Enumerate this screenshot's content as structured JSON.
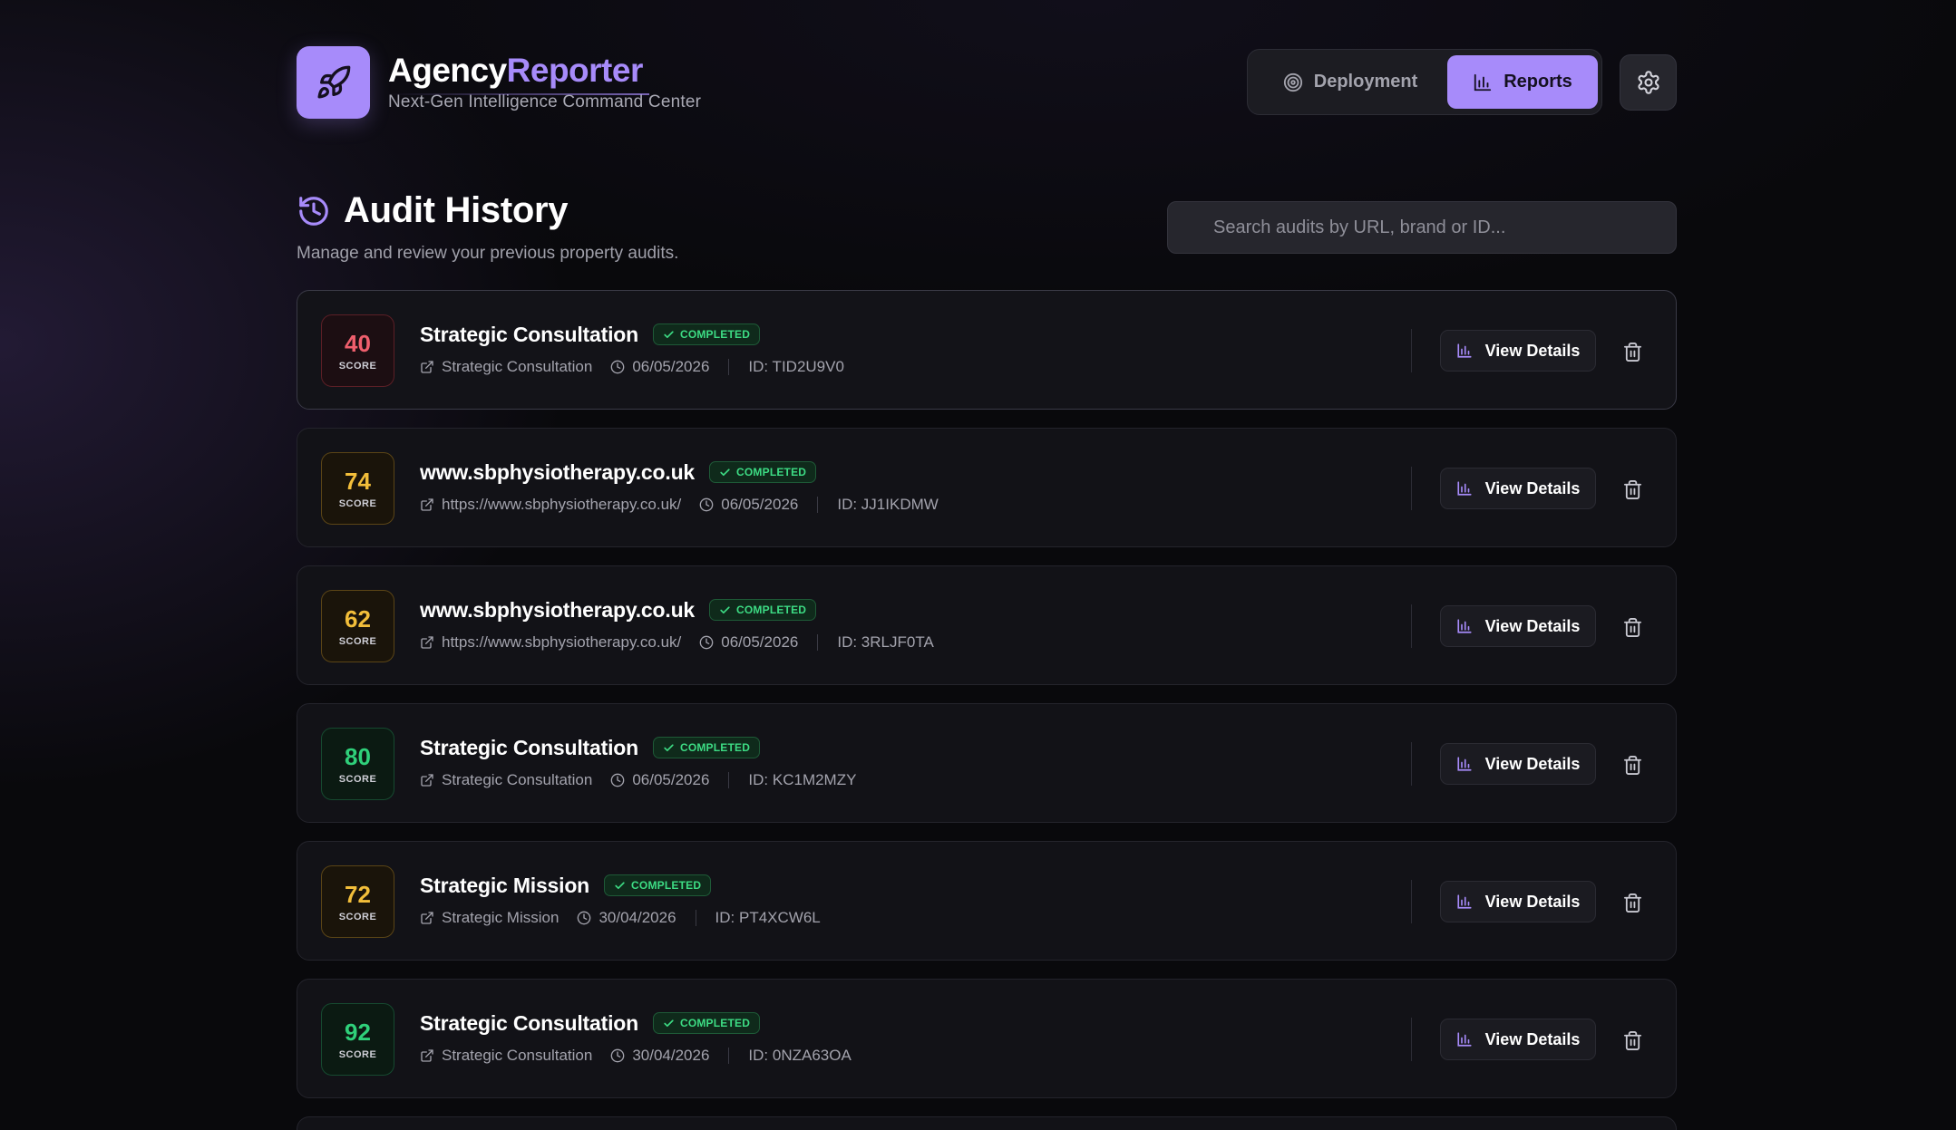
{
  "app": {
    "brand_part1": "Agency",
    "brand_part2": "Reporter",
    "tagline": "Next-Gen Intelligence Command Center",
    "logo_icon": "rocket-icon",
    "accent_color": "#a78bfa"
  },
  "nav": {
    "tabs": [
      {
        "label": "Deployment",
        "icon": "target-icon",
        "active": false
      },
      {
        "label": "Reports",
        "icon": "bar-chart-icon",
        "active": true
      }
    ],
    "settings_icon": "gear-icon"
  },
  "page": {
    "title": "Audit History",
    "title_icon": "history-icon",
    "subtitle": "Manage and review your previous property audits."
  },
  "search": {
    "placeholder": "Search audits by URL, brand or ID...",
    "value": ""
  },
  "audits": [
    {
      "score": "40",
      "score_label": "SCORE",
      "score_level": "red",
      "title": "Strategic Consultation",
      "status": "COMPLETED",
      "source": "Strategic Consultation",
      "date": "06/05/2026",
      "id": "ID: TID2U9V0",
      "view_label": "View Details"
    },
    {
      "score": "74",
      "score_label": "SCORE",
      "score_level": "amber",
      "title": "www.sbphysiotherapy.co.uk",
      "status": "COMPLETED",
      "source": "https://www.sbphysiotherapy.co.uk/",
      "date": "06/05/2026",
      "id": "ID: JJ1IKDMW",
      "view_label": "View Details"
    },
    {
      "score": "62",
      "score_label": "SCORE",
      "score_level": "amber",
      "title": "www.sbphysiotherapy.co.uk",
      "status": "COMPLETED",
      "source": "https://www.sbphysiotherapy.co.uk/",
      "date": "06/05/2026",
      "id": "ID: 3RLJF0TA",
      "view_label": "View Details"
    },
    {
      "score": "80",
      "score_label": "SCORE",
      "score_level": "green",
      "title": "Strategic Consultation",
      "status": "COMPLETED",
      "source": "Strategic Consultation",
      "date": "06/05/2026",
      "id": "ID: KC1M2MZY",
      "view_label": "View Details"
    },
    {
      "score": "72",
      "score_label": "SCORE",
      "score_level": "amber",
      "title": "Strategic Mission",
      "status": "COMPLETED",
      "source": "Strategic Mission",
      "date": "30/04/2026",
      "id": "ID: PT4XCW6L",
      "view_label": "View Details"
    },
    {
      "score": "92",
      "score_label": "SCORE",
      "score_level": "green",
      "title": "Strategic Consultation",
      "status": "COMPLETED",
      "source": "Strategic Consultation",
      "date": "30/04/2026",
      "id": "ID: 0NZA63OA",
      "view_label": "View Details"
    }
  ],
  "colors": {
    "score_red": "#ef5f6d",
    "score_amber": "#f2be3a",
    "score_green": "#2fd07a",
    "status_completed": "#3ddc84"
  }
}
